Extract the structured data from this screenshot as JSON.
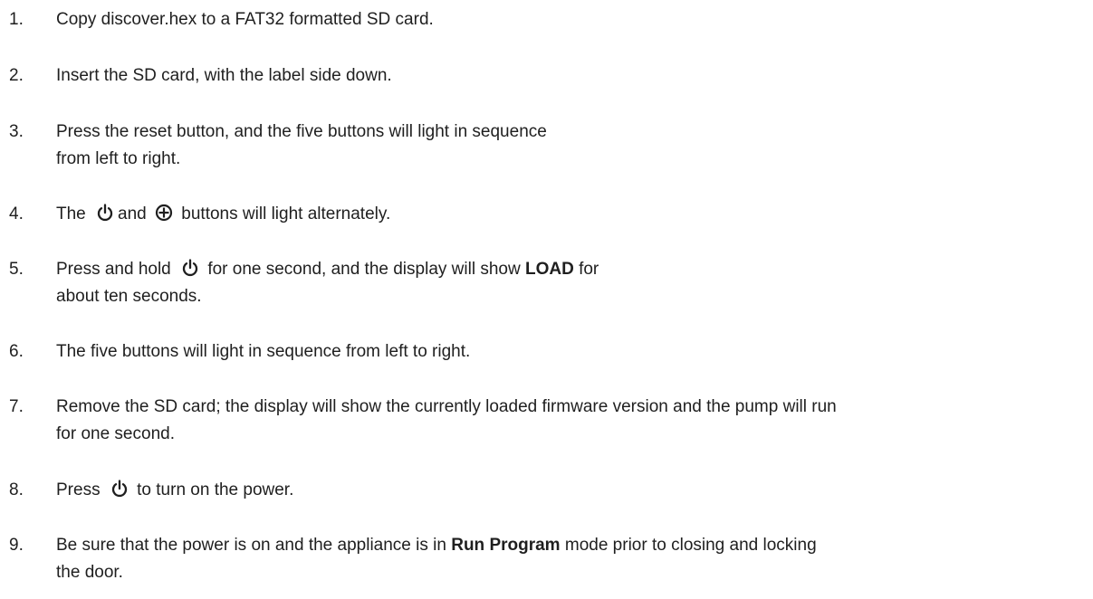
{
  "steps": [
    {
      "number": "1.",
      "text": "Copy discover.hex to a FAT32 formatted SD card."
    },
    {
      "number": "2.",
      "text": "Insert the SD card, with the label side down."
    },
    {
      "number": "3.",
      "line1": "Press the reset button, and the five buttons will light in sequence",
      "line2": "from left to right."
    },
    {
      "number": "4.",
      "pre": "The",
      "mid": "and",
      "post": "buttons will light alternately.",
      "icons": [
        "power-icon",
        "plus-circle-icon"
      ]
    },
    {
      "number": "5.",
      "pre": "Press and hold",
      "mid": "for one second, and the display will show",
      "bold": "LOAD",
      "post": "for",
      "line2": "about ten seconds.",
      "icons": [
        "power-icon"
      ]
    },
    {
      "number": "6.",
      "text": "The five buttons will light in sequence from left to right."
    },
    {
      "number": "7.",
      "line1": "Remove the SD card; the display will show the currently loaded firmware version and the pump will run",
      "line2": "for one second."
    },
    {
      "number": "8.",
      "pre": "Press",
      "post": "to turn on the power.",
      "icons": [
        "power-icon"
      ]
    },
    {
      "number": "9.",
      "pre": "Be sure that the power is on and the appliance is in",
      "bold": "Run Program",
      "post": "mode prior to closing and locking",
      "line2": "the door."
    }
  ]
}
